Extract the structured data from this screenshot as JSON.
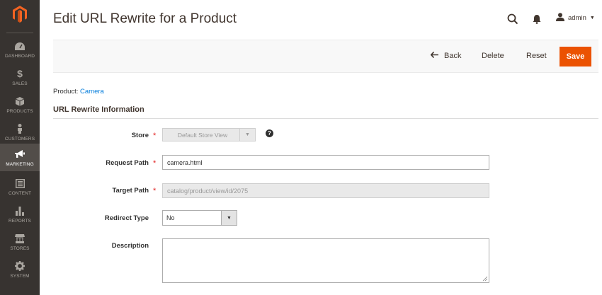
{
  "app": {
    "page_title": "Edit URL Rewrite for a Product",
    "user": "admin"
  },
  "sidebar": {
    "items": [
      {
        "label": "DASHBOARD",
        "icon": "gauge-icon",
        "active": false
      },
      {
        "label": "SALES",
        "icon": "dollar-icon",
        "active": false
      },
      {
        "label": "PRODUCTS",
        "icon": "cube-icon",
        "active": false
      },
      {
        "label": "CUSTOMERS",
        "icon": "person-icon",
        "active": false
      },
      {
        "label": "MARKETING",
        "icon": "megaphone-icon",
        "active": true
      },
      {
        "label": "CONTENT",
        "icon": "layout-icon",
        "active": false
      },
      {
        "label": "REPORTS",
        "icon": "bar-chart-icon",
        "active": false
      },
      {
        "label": "STORES",
        "icon": "storefront-icon",
        "active": false
      },
      {
        "label": "SYSTEM",
        "icon": "gear-icon",
        "active": false
      }
    ]
  },
  "toolbar": {
    "back_label": "Back",
    "delete_label": "Delete",
    "reset_label": "Reset",
    "save_label": "Save"
  },
  "content": {
    "product_prefix": "Product: ",
    "product_name": "Camera",
    "section_title": "URL Rewrite Information"
  },
  "form": {
    "store": {
      "label": "Store",
      "value": "Default Store View",
      "required": true
    },
    "request_path": {
      "label": "Request Path",
      "value": "camera.html",
      "required": true
    },
    "target_path": {
      "label": "Target Path",
      "value": "catalog/product/view/id/2075",
      "required": true
    },
    "redirect_type": {
      "label": "Redirect Type",
      "value": "No"
    },
    "description": {
      "label": "Description",
      "value": ""
    }
  },
  "colors": {
    "sidebar_bg": "#373330",
    "accent": "#eb5202",
    "link": "#007bdb",
    "required": "#e22626"
  }
}
